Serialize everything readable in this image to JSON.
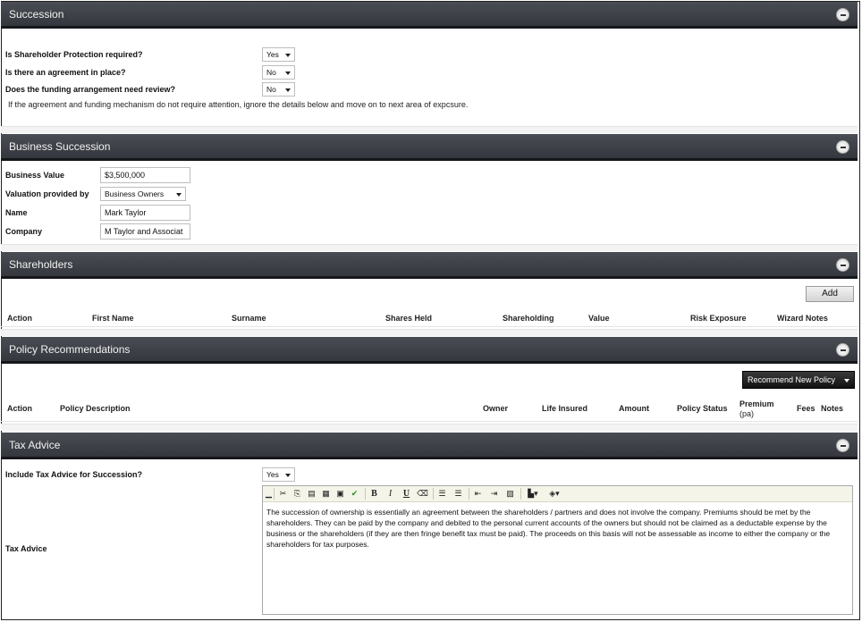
{
  "sections": {
    "succession": {
      "title": "Succession"
    },
    "business_succession": {
      "title": "Business Succession"
    },
    "shareholders": {
      "title": "Shareholders"
    },
    "policy_recommendations": {
      "title": "Policy Recommendations"
    },
    "tax_advice": {
      "title": "Tax Advice"
    }
  },
  "succession": {
    "q1_label": "Is Shareholder Protection required?",
    "q1_value": "Yes",
    "q2_label": "Is there an agreement in place?",
    "q2_value": "No",
    "q3_label": "Does the funding arrangement need review?",
    "q3_value": "No",
    "note": "If the agreement and funding mechanism do not require attention, ignore the details below and move on to next area of expcsure."
  },
  "business": {
    "value_label": "Business Value",
    "value": "$3,500,000",
    "valuation_label": "Valuation provided by",
    "valuation_value": "Business Owners",
    "name_label": "Name",
    "name_value": "Mark Taylor",
    "company_label": "Company",
    "company_value": "M Taylor and Associat"
  },
  "shareholders": {
    "add_label": "Add",
    "columns": [
      "Action",
      "First Name",
      "Surname",
      "Shares Held",
      "Shareholding",
      "Value",
      "Risk Exposure",
      "Wizard Notes"
    ]
  },
  "policy": {
    "recommend_label": "Recommend New Policy",
    "columns": [
      "Action",
      "Policy Description",
      "Owner",
      "Life Insured",
      "Amount",
      "Policy Status",
      "Premium",
      "(pa)",
      "Fees",
      "Notes"
    ]
  },
  "tax": {
    "include_label": "Include Tax Advice for Succession?",
    "include_value": "Yes",
    "advice_label": "Tax Advice",
    "advice_text": "The succession of ownership is essentially an agreement between the shareholders / partners and does not involve the company. Premiums should be met by the shareholders. They can be paid by the company and debited to the personal current accounts of the owners but should not be claimed as a deductable expense by the business or the shareholders (if they are then fringe benefit tax must be paid). The proceeds on this basis will not be assessable as income to either the company or the shareholders for tax purposes."
  },
  "toolbar_icons": [
    "cut-icon",
    "copy-icon",
    "paste-icon",
    "paste-text-icon",
    "paste-word-icon",
    "spellcheck-icon",
    "bold-icon",
    "italic-icon",
    "underline-icon",
    "eraser-icon",
    "ordered-list-icon",
    "unordered-list-icon",
    "outdent-icon",
    "indent-icon",
    "image-icon",
    "text-color-icon",
    "background-color-icon"
  ],
  "toolbar_text": {
    "bold": "B",
    "italic": "I",
    "underline": "U"
  },
  "colors": {
    "header_bg": "#3c3f45",
    "header_text": "#f2f2f2",
    "dark_button": "#1a1a1a",
    "toolbar_bg": "#f4f4e8"
  }
}
